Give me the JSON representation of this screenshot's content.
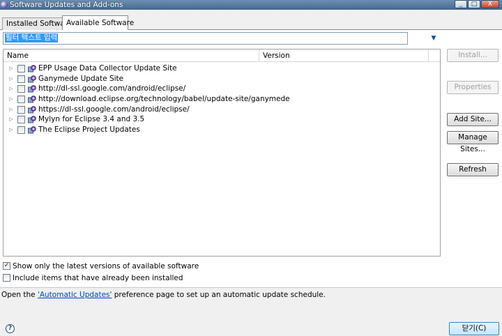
{
  "window": {
    "title": "Software Updates and Add-ons",
    "controls": [
      "_",
      "□",
      "X"
    ]
  },
  "tabs": [
    {
      "label": "Installed Software",
      "active": false
    },
    {
      "label": "Available Software",
      "active": true
    }
  ],
  "filter": {
    "value": "필터 텍스트 입력"
  },
  "table": {
    "columns": [
      "Name",
      "Version"
    ],
    "rows": [
      {
        "name": "EPP Usage Data Collector Update Site",
        "version": ""
      },
      {
        "name": "Ganymede Update Site",
        "version": ""
      },
      {
        "name": "http://dl-ssl.google.com/android/eclipse/",
        "version": ""
      },
      {
        "name": "http://download.eclipse.org/technology/babel/update-site/ganymede",
        "version": ""
      },
      {
        "name": "https://dl-ssl.google.com/android/eclipse/",
        "version": ""
      },
      {
        "name": "Mylyn for Eclipse 3.4 and 3.5",
        "version": ""
      },
      {
        "name": "The Eclipse Project Updates",
        "version": ""
      }
    ]
  },
  "buttons": {
    "install": "Install...",
    "properties": "Properties",
    "add_site": "Add Site...",
    "manage_sites": "Manage Sites...",
    "refresh": "Refresh"
  },
  "options": {
    "latest_only": {
      "label": "Show only the latest versions of available software",
      "checked": true
    },
    "include_installed": {
      "label": "Include items that have already been installed",
      "checked": false
    }
  },
  "footer": {
    "prefix": "Open the ",
    "link": "'Automatic Updates'",
    "suffix": " preference page to set up an automatic update schedule."
  },
  "dialog": {
    "close_label": "닫기(C)"
  },
  "icons": {
    "app": "eclipse-icon",
    "expander": "expand-triangle-icon",
    "site": "update-site-icon",
    "help": "help-icon"
  },
  "colors": {
    "accent": "#3399ff",
    "link": "#0044bb",
    "titlebar": "#45698f"
  }
}
